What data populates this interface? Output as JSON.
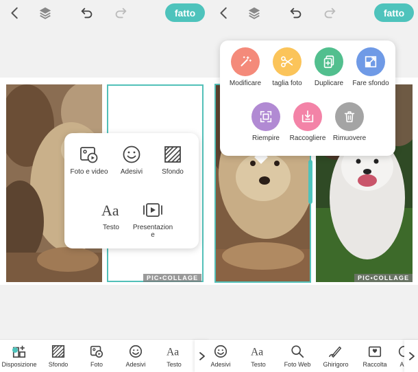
{
  "left": {
    "done_label": "fatto",
    "add_menu": [
      {
        "label": "Foto e video",
        "icon": "photo-video-icon"
      },
      {
        "label": "Adesivi",
        "icon": "smiley-icon"
      },
      {
        "label": "Sfondo",
        "icon": "background-pattern-icon"
      },
      {
        "label": "Testo",
        "icon": "text-aa-icon"
      },
      {
        "label": "Presentazion\ne",
        "icon": "slideshow-icon"
      }
    ],
    "watermark": "PIC•COLLAGE",
    "toolbar": [
      {
        "label": "Disposizione",
        "icon": "layout-icon"
      },
      {
        "label": "Sfondo",
        "icon": "background-pattern-icon"
      },
      {
        "label": "Foto",
        "icon": "photo-icon"
      },
      {
        "label": "Adesivi",
        "icon": "smiley-icon"
      },
      {
        "label": "Testo",
        "icon": "text-aa-icon"
      }
    ]
  },
  "right": {
    "done_label": "fatto",
    "photo_menu": [
      {
        "label": "Modificare",
        "icon": "magic-wand-icon",
        "color": "#f48a7a"
      },
      {
        "label": "taglia foto",
        "icon": "scissors-icon",
        "color": "#fbc45a"
      },
      {
        "label": "Duplicare",
        "icon": "duplicate-icon",
        "color": "#52bf8e"
      },
      {
        "label": "Fare sfondo",
        "icon": "make-background-icon",
        "color": "#6f9ae6"
      },
      {
        "label": "Riempire",
        "icon": "fill-icon",
        "color": "#b18ad3"
      },
      {
        "label": "Raccogliere",
        "icon": "collect-icon",
        "color": "#f383a7"
      },
      {
        "label": "Rimuovere",
        "icon": "trash-icon",
        "color": "#a4a4a4"
      }
    ],
    "watermark": "PIC•COLLAGE",
    "toolbar": [
      {
        "label": "Adesivi",
        "icon": "smiley-icon"
      },
      {
        "label": "Testo",
        "icon": "text-aa-icon"
      },
      {
        "label": "Foto Web",
        "icon": "search-icon"
      },
      {
        "label": "Ghirigoro",
        "icon": "doodle-brush-icon"
      },
      {
        "label": "Raccolta",
        "icon": "collection-icon"
      },
      {
        "label": "Ani",
        "icon": "animation-icon"
      }
    ]
  },
  "colors": {
    "accent": "#4ec3bc"
  }
}
